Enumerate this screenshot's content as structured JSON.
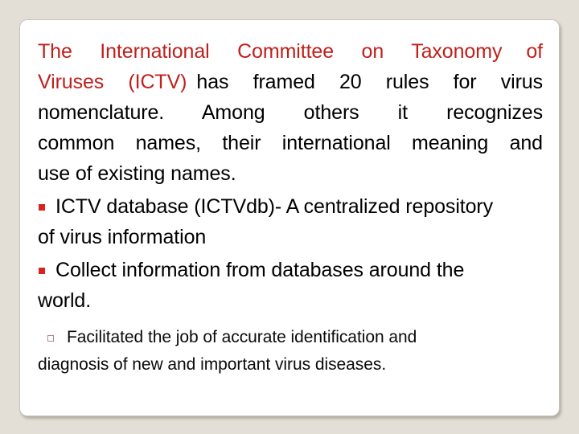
{
  "slide": {
    "background_color": "#e4dfd6",
    "panel_color": "#ffffff",
    "accent_color": "#c0201c",
    "bullet_color": "#d8241f",
    "subbullet_color": "#b57f9a",
    "paragraph": {
      "red_lead_1": "The International Committee on Taxonomy",
      "red_lead_2": "of",
      "red_lead_3": "Viruses  (ICTV)",
      "body_rest_1": "has  framed  20  rules  for  virus",
      "body_rest_2": "nomenclature.    Among    others    it    recognizes",
      "body_rest_3": "common  names,  their  international  meaning  and",
      "body_rest_4": "use of existing names."
    },
    "bullets": [
      {
        "level": 1,
        "marker": "solid-square-bullet-icon",
        "line_1": "ICTV database (ICTVdb)- A centralized repository",
        "line_2": "of virus information"
      },
      {
        "level": 1,
        "marker": "solid-square-bullet-icon",
        "line_1": "Collect   information    from databases around the",
        "line_2": "world."
      },
      {
        "level": 2,
        "marker": "hollow-square-bullet-icon",
        "line_1": "Facilitated the job of accurate identification and",
        "line_2": "diagnosis of new and important virus diseases."
      }
    ]
  }
}
